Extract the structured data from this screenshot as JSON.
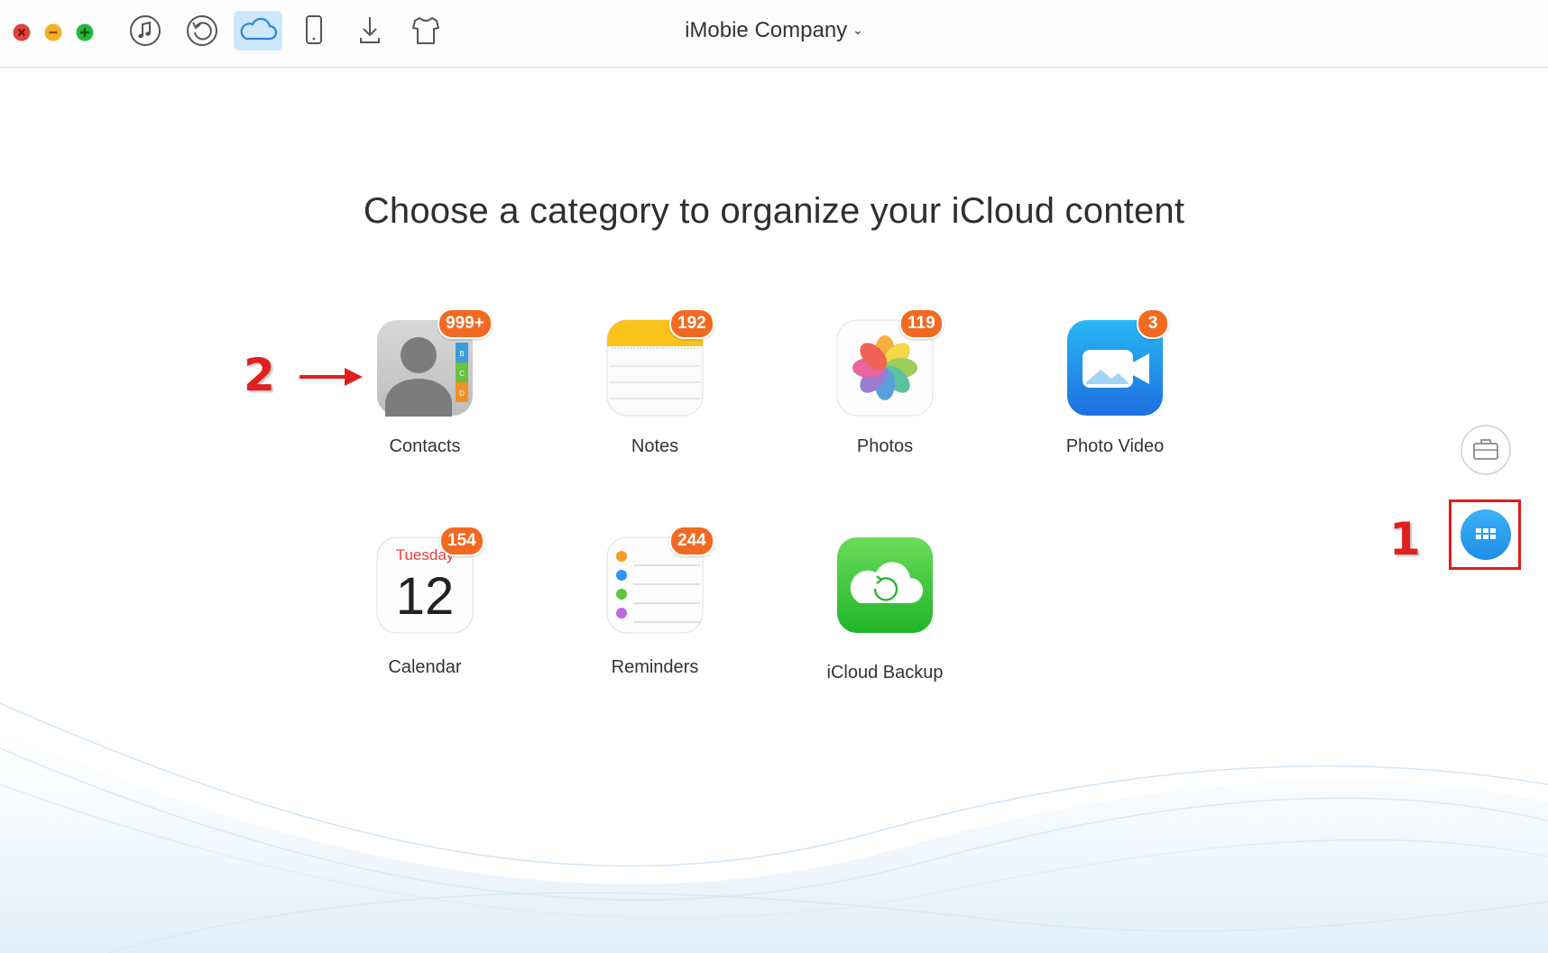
{
  "window": {
    "controls": [
      "close",
      "minimize",
      "zoom"
    ]
  },
  "toolbar": {
    "buttons": [
      {
        "name": "itunes-library-button",
        "icon": "music-note-icon"
      },
      {
        "name": "itunes-backup-button",
        "icon": "restore-icon"
      },
      {
        "name": "icloud-button",
        "icon": "cloud-icon",
        "active": true
      },
      {
        "name": "device-button",
        "icon": "phone-icon"
      },
      {
        "name": "download-button",
        "icon": "download-icon"
      },
      {
        "name": "theme-button",
        "icon": "tshirt-icon"
      }
    ],
    "account": "iMobie Company",
    "account_chevron": "⌄"
  },
  "main": {
    "headline": "Choose a category to organize your iCloud content",
    "categories": [
      {
        "label": "Contacts",
        "badge": "999+",
        "icon": "contacts-icon"
      },
      {
        "label": "Notes",
        "badge": "192",
        "icon": "notes-icon"
      },
      {
        "label": "Photos",
        "badge": "119",
        "icon": "photos-icon"
      },
      {
        "label": "Photo Video",
        "badge": "3",
        "icon": "photo-video-icon"
      },
      {
        "label": "Calendar",
        "badge": "154",
        "icon": "calendar-icon",
        "day": "Tuesday",
        "date": "12"
      },
      {
        "label": "Reminders",
        "badge": "244",
        "icon": "reminders-icon"
      },
      {
        "label": "iCloud Backup",
        "badge": "",
        "icon": "icloud-backup-icon"
      }
    ]
  },
  "sidebar": {
    "buttons": [
      {
        "name": "toolkit-button",
        "icon": "briefcase-icon"
      },
      {
        "name": "category-mode-button",
        "icon": "grid-icon",
        "active": true
      }
    ]
  },
  "annotations": {
    "step1": "1",
    "step2": "2"
  },
  "colors": {
    "accent": "#2a9af0",
    "badge": "#f26a21",
    "annotation": "#e01f1f"
  }
}
